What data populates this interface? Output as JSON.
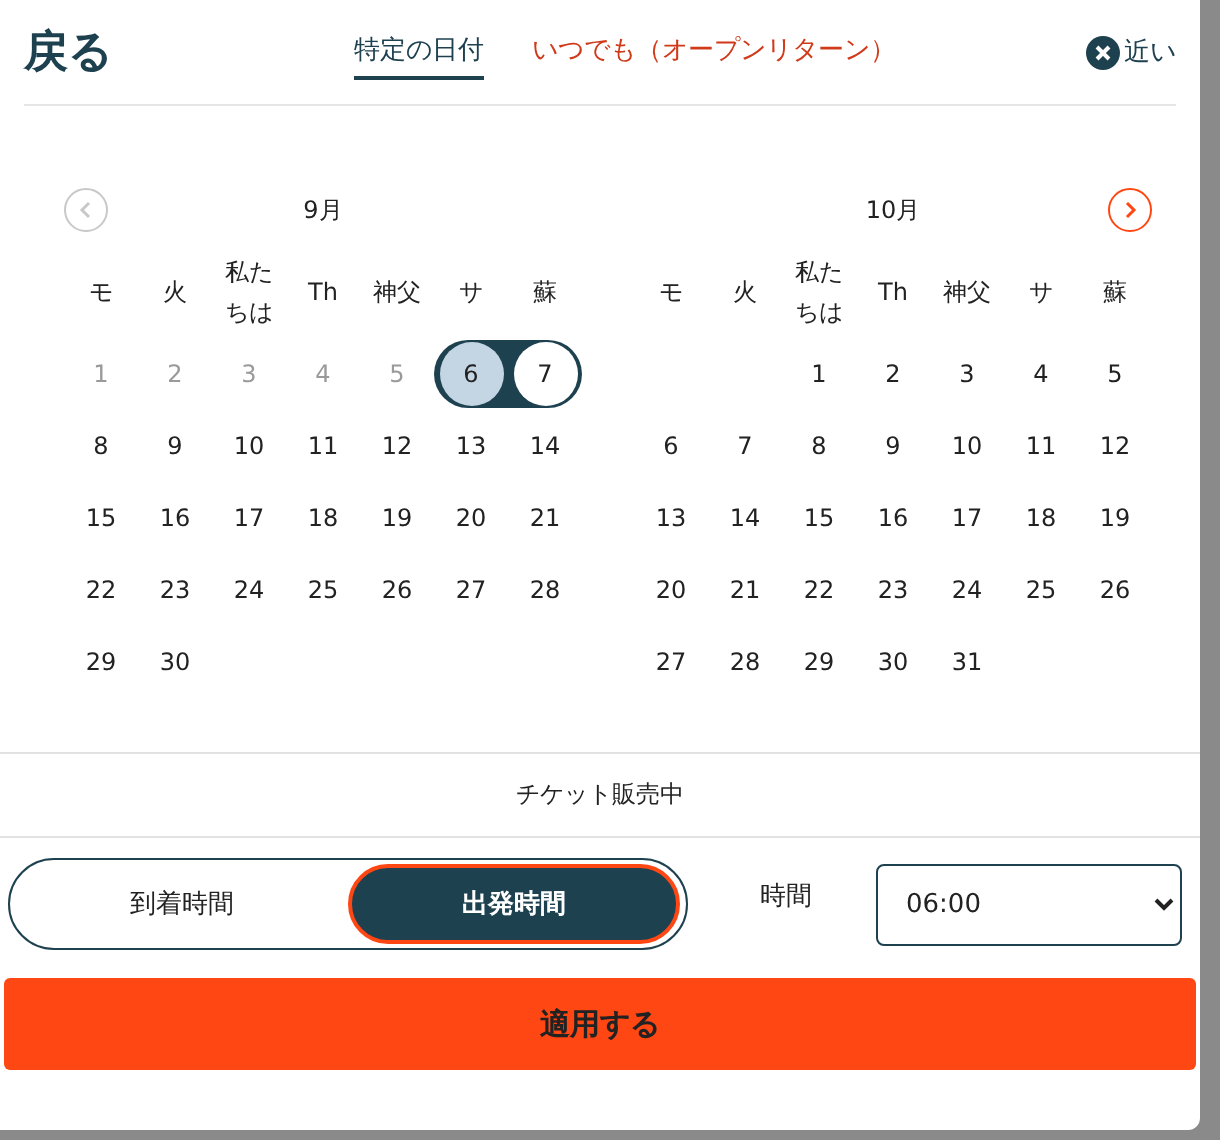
{
  "header": {
    "back": "戻る",
    "tabs": [
      {
        "label": "特定の日付",
        "selected": true
      },
      {
        "label": "いつでも（オープンリターン）",
        "selected": false
      }
    ],
    "close": "近い"
  },
  "nav": {
    "prev_disabled": true,
    "next_disabled": false
  },
  "months": [
    {
      "title": "9月",
      "weekdays": [
        "モ",
        "火",
        "私たちは",
        "Th",
        "神父",
        "サ",
        "蘇"
      ],
      "days": [
        {
          "kind": "day",
          "label": "1",
          "disabled": true
        },
        {
          "kind": "day",
          "label": "2",
          "disabled": true
        },
        {
          "kind": "day",
          "label": "3",
          "disabled": true
        },
        {
          "kind": "day",
          "label": "4",
          "disabled": true
        },
        {
          "kind": "day",
          "label": "5",
          "disabled": true
        },
        {
          "kind": "range-start",
          "label": "6",
          "disabled": false
        },
        {
          "kind": "range-end",
          "label": "7",
          "disabled": false
        },
        {
          "kind": "day",
          "label": "8",
          "disabled": false
        },
        {
          "kind": "day",
          "label": "9",
          "disabled": false
        },
        {
          "kind": "day",
          "label": "10",
          "disabled": false
        },
        {
          "kind": "day",
          "label": "11",
          "disabled": false
        },
        {
          "kind": "day",
          "label": "12",
          "disabled": false
        },
        {
          "kind": "day",
          "label": "13",
          "disabled": false
        },
        {
          "kind": "day",
          "label": "14",
          "disabled": false
        },
        {
          "kind": "day",
          "label": "15",
          "disabled": false
        },
        {
          "kind": "day",
          "label": "16",
          "disabled": false
        },
        {
          "kind": "day",
          "label": "17",
          "disabled": false
        },
        {
          "kind": "day",
          "label": "18",
          "disabled": false
        },
        {
          "kind": "day",
          "label": "19",
          "disabled": false
        },
        {
          "kind": "day",
          "label": "20",
          "disabled": false
        },
        {
          "kind": "day",
          "label": "21",
          "disabled": false
        },
        {
          "kind": "day",
          "label": "22",
          "disabled": false
        },
        {
          "kind": "day",
          "label": "23",
          "disabled": false
        },
        {
          "kind": "day",
          "label": "24",
          "disabled": false
        },
        {
          "kind": "day",
          "label": "25",
          "disabled": false
        },
        {
          "kind": "day",
          "label": "26",
          "disabled": false
        },
        {
          "kind": "day",
          "label": "27",
          "disabled": false
        },
        {
          "kind": "day",
          "label": "28",
          "disabled": false
        },
        {
          "kind": "day",
          "label": "29",
          "disabled": false
        },
        {
          "kind": "day",
          "label": "30",
          "disabled": false
        }
      ]
    },
    {
      "title": "10月",
      "weekdays": [
        "モ",
        "火",
        "私たちは",
        "Th",
        "神父",
        "サ",
        "蘇"
      ],
      "days": [
        {
          "kind": "blank"
        },
        {
          "kind": "blank"
        },
        {
          "kind": "day",
          "label": "1",
          "disabled": false
        },
        {
          "kind": "day",
          "label": "2",
          "disabled": false
        },
        {
          "kind": "day",
          "label": "3",
          "disabled": false
        },
        {
          "kind": "day",
          "label": "4",
          "disabled": false
        },
        {
          "kind": "day",
          "label": "5",
          "disabled": false
        },
        {
          "kind": "day",
          "label": "6",
          "disabled": false
        },
        {
          "kind": "day",
          "label": "7",
          "disabled": false
        },
        {
          "kind": "day",
          "label": "8",
          "disabled": false
        },
        {
          "kind": "day",
          "label": "9",
          "disabled": false
        },
        {
          "kind": "day",
          "label": "10",
          "disabled": false
        },
        {
          "kind": "day",
          "label": "11",
          "disabled": false
        },
        {
          "kind": "day",
          "label": "12",
          "disabled": false
        },
        {
          "kind": "day",
          "label": "13",
          "disabled": false
        },
        {
          "kind": "day",
          "label": "14",
          "disabled": false
        },
        {
          "kind": "day",
          "label": "15",
          "disabled": false
        },
        {
          "kind": "day",
          "label": "16",
          "disabled": false
        },
        {
          "kind": "day",
          "label": "17",
          "disabled": false
        },
        {
          "kind": "day",
          "label": "18",
          "disabled": false
        },
        {
          "kind": "day",
          "label": "19",
          "disabled": false
        },
        {
          "kind": "day",
          "label": "20",
          "disabled": false
        },
        {
          "kind": "day",
          "label": "21",
          "disabled": false
        },
        {
          "kind": "day",
          "label": "22",
          "disabled": false
        },
        {
          "kind": "day",
          "label": "23",
          "disabled": false
        },
        {
          "kind": "day",
          "label": "24",
          "disabled": false
        },
        {
          "kind": "day",
          "label": "25",
          "disabled": false
        },
        {
          "kind": "day",
          "label": "26",
          "disabled": false
        },
        {
          "kind": "day",
          "label": "27",
          "disabled": false
        },
        {
          "kind": "day",
          "label": "28",
          "disabled": false
        },
        {
          "kind": "day",
          "label": "29",
          "disabled": false
        },
        {
          "kind": "day",
          "label": "30",
          "disabled": false
        },
        {
          "kind": "day",
          "label": "31",
          "disabled": false
        }
      ]
    }
  ],
  "notice": "チケット販売中",
  "time_mode": [
    {
      "label": "到着時間",
      "selected": false
    },
    {
      "label": "出発時間",
      "selected": true
    }
  ],
  "time": {
    "label": "時間",
    "value": "06:00"
  },
  "apply": "適用する"
}
